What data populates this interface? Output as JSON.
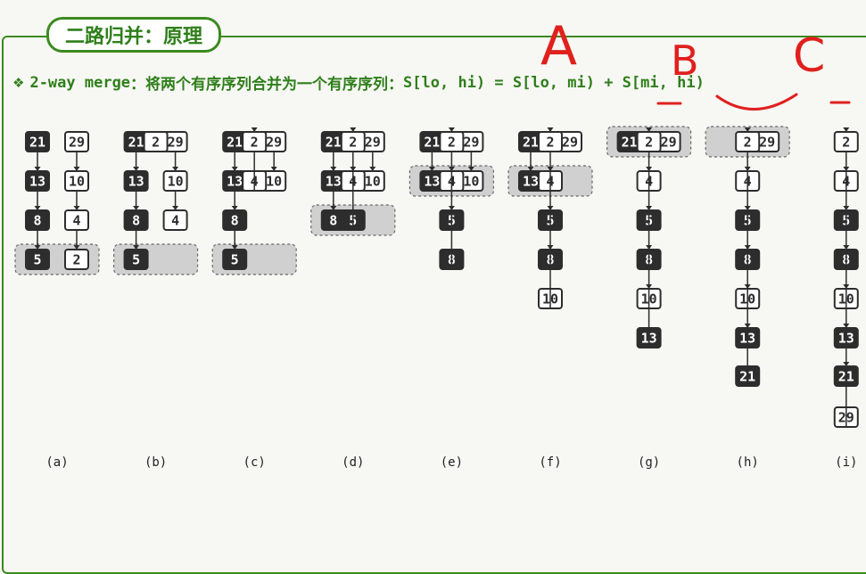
{
  "header": {
    "title": "二路归并：原理",
    "bullet": "❖",
    "subtitle_prefix": "2-way merge",
    "subtitle_text": "：将两个有序序列合并为一个有序序列：",
    "formula": "S[lo, hi) = S[lo, mi) + S[mi, hi)"
  },
  "annotations": {
    "a": "A",
    "b": "B",
    "c": "C"
  },
  "colors": {
    "green": "#2f7f1a",
    "dark": "#2d2d2d",
    "red": "#e0201c",
    "group": "#d0d0d0"
  },
  "diagram": {
    "steps": [
      {
        "label": "(a)",
        "group": {
          "left": [
            5
          ],
          "right": [
            2
          ]
        },
        "columns": [
          {
            "type": "left",
            "values": [
              21,
              13,
              8,
              5
            ]
          },
          {
            "type": "right",
            "values": [
              29,
              10,
              4,
              2
            ]
          }
        ],
        "output": []
      },
      {
        "label": "(b)",
        "group": {
          "left": [
            5
          ],
          "right": [
            4
          ]
        },
        "columns": [
          {
            "type": "left",
            "values": [
              21,
              13,
              8,
              5
            ]
          },
          {
            "type": "right",
            "values": [
              29,
              10,
              4
            ]
          }
        ],
        "output": [
          2
        ]
      },
      {
        "label": "(c)",
        "group": {
          "left": [
            5
          ],
          "right": [
            10
          ]
        },
        "columns": [
          {
            "type": "left",
            "values": [
              21,
              13,
              8,
              5
            ]
          },
          {
            "type": "right",
            "values": [
              29,
              10
            ]
          }
        ],
        "output": [
          4,
          2
        ]
      },
      {
        "label": "(d)",
        "group": {
          "left": [
            8
          ],
          "right": [
            10
          ]
        },
        "columns": [
          {
            "type": "left",
            "values": [
              21,
              13,
              8
            ]
          },
          {
            "type": "right",
            "values": [
              29,
              10
            ]
          }
        ],
        "output": [
          5,
          4,
          2
        ]
      },
      {
        "label": "(e)",
        "group": {
          "left": [
            13
          ],
          "right": [
            10
          ]
        },
        "columns": [
          {
            "type": "left",
            "values": [
              21,
              13
            ]
          },
          {
            "type": "right",
            "values": [
              29,
              10
            ]
          }
        ],
        "output": [
          8,
          5,
          4,
          2
        ]
      },
      {
        "label": "(f)",
        "group": {
          "left": [
            13
          ],
          "right": [
            29
          ]
        },
        "columns": [
          {
            "type": "left",
            "values": [
              21,
              13
            ]
          },
          {
            "type": "right",
            "values": [
              29
            ]
          }
        ],
        "output": [
          10,
          8,
          5,
          4,
          2
        ]
      },
      {
        "label": "(g)",
        "group": {
          "left": [
            21
          ],
          "right": [
            29
          ]
        },
        "columns": [
          {
            "type": "left",
            "values": [
              21
            ]
          },
          {
            "type": "right",
            "values": [
              29
            ]
          }
        ],
        "output": [
          13,
          10,
          8,
          5,
          4,
          2
        ]
      },
      {
        "label": "(h)",
        "group": {
          "left": [],
          "right": [
            29
          ]
        },
        "columns": [
          {
            "type": "left",
            "values": []
          },
          {
            "type": "right",
            "values": [
              29
            ]
          }
        ],
        "output": [
          21,
          13,
          10,
          8,
          5,
          4,
          2
        ]
      },
      {
        "label": "(i)",
        "group": null,
        "columns": [],
        "output": [
          29,
          21,
          13,
          10,
          8,
          5,
          4,
          2
        ]
      }
    ]
  }
}
